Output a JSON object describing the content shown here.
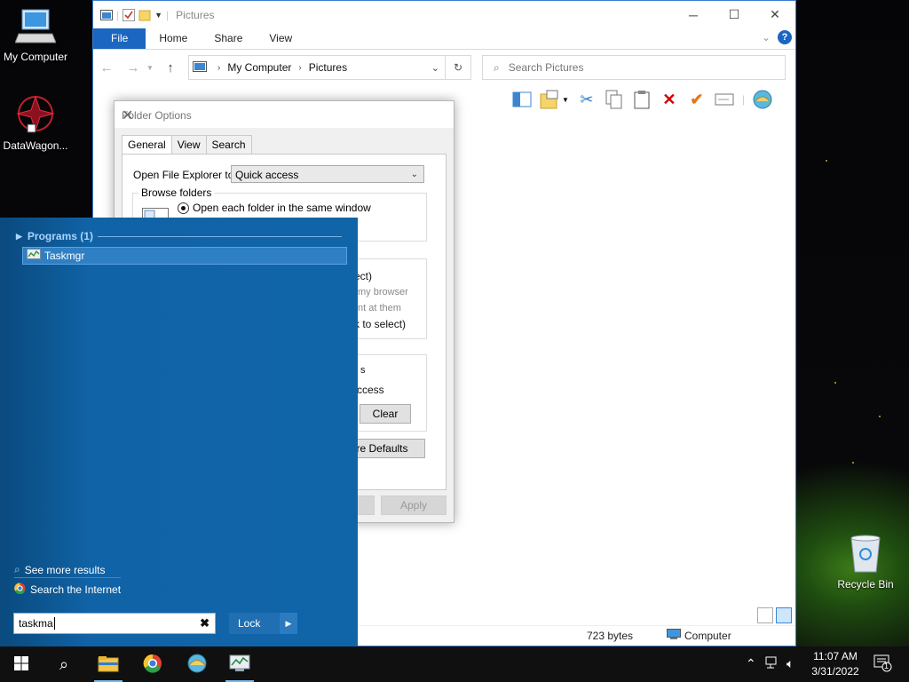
{
  "desktop": {
    "icons": [
      {
        "label": "My Computer"
      },
      {
        "label": "DataWagon..."
      },
      {
        "label": "Recycle Bin"
      }
    ]
  },
  "explorer": {
    "title": "Pictures",
    "ribbon_tabs": [
      "File",
      "Home",
      "Share",
      "View"
    ],
    "breadcrumb": [
      "My Computer",
      "Pictures"
    ],
    "search_placeholder": "Search Pictures",
    "status_size": "723 bytes",
    "status_location": "Computer"
  },
  "dialog": {
    "title": "Folder Options",
    "tabs": [
      "General",
      "View",
      "Search"
    ],
    "open_explorer_label": "Open File Explorer to:",
    "open_explorer_value": "Quick access",
    "browse_group": "Browse folders",
    "browse_option": "Open each folder in the same window",
    "click_fragments": [
      "ect)",
      "my browser",
      "nt at them",
      "k to select)"
    ],
    "privacy_fragments": [
      "s",
      "ccess"
    ],
    "clear_label": "Clear",
    "restore_label": "tore Defaults",
    "apply_label": "Apply"
  },
  "start": {
    "programs_header": "Programs (1)",
    "result_label": "Taskmgr",
    "see_more": "See more results",
    "search_internet": "Search the Internet",
    "search_value": "taskma",
    "lock_label": "Lock"
  },
  "taskbar": {
    "time": "11:07 AM",
    "date": "3/31/2022",
    "notification_count": "1"
  },
  "colors": {
    "accent": "#1a66c0",
    "start_panel": "#1064a8",
    "close_red": "#d40000",
    "check_orange": "#e8761a"
  }
}
